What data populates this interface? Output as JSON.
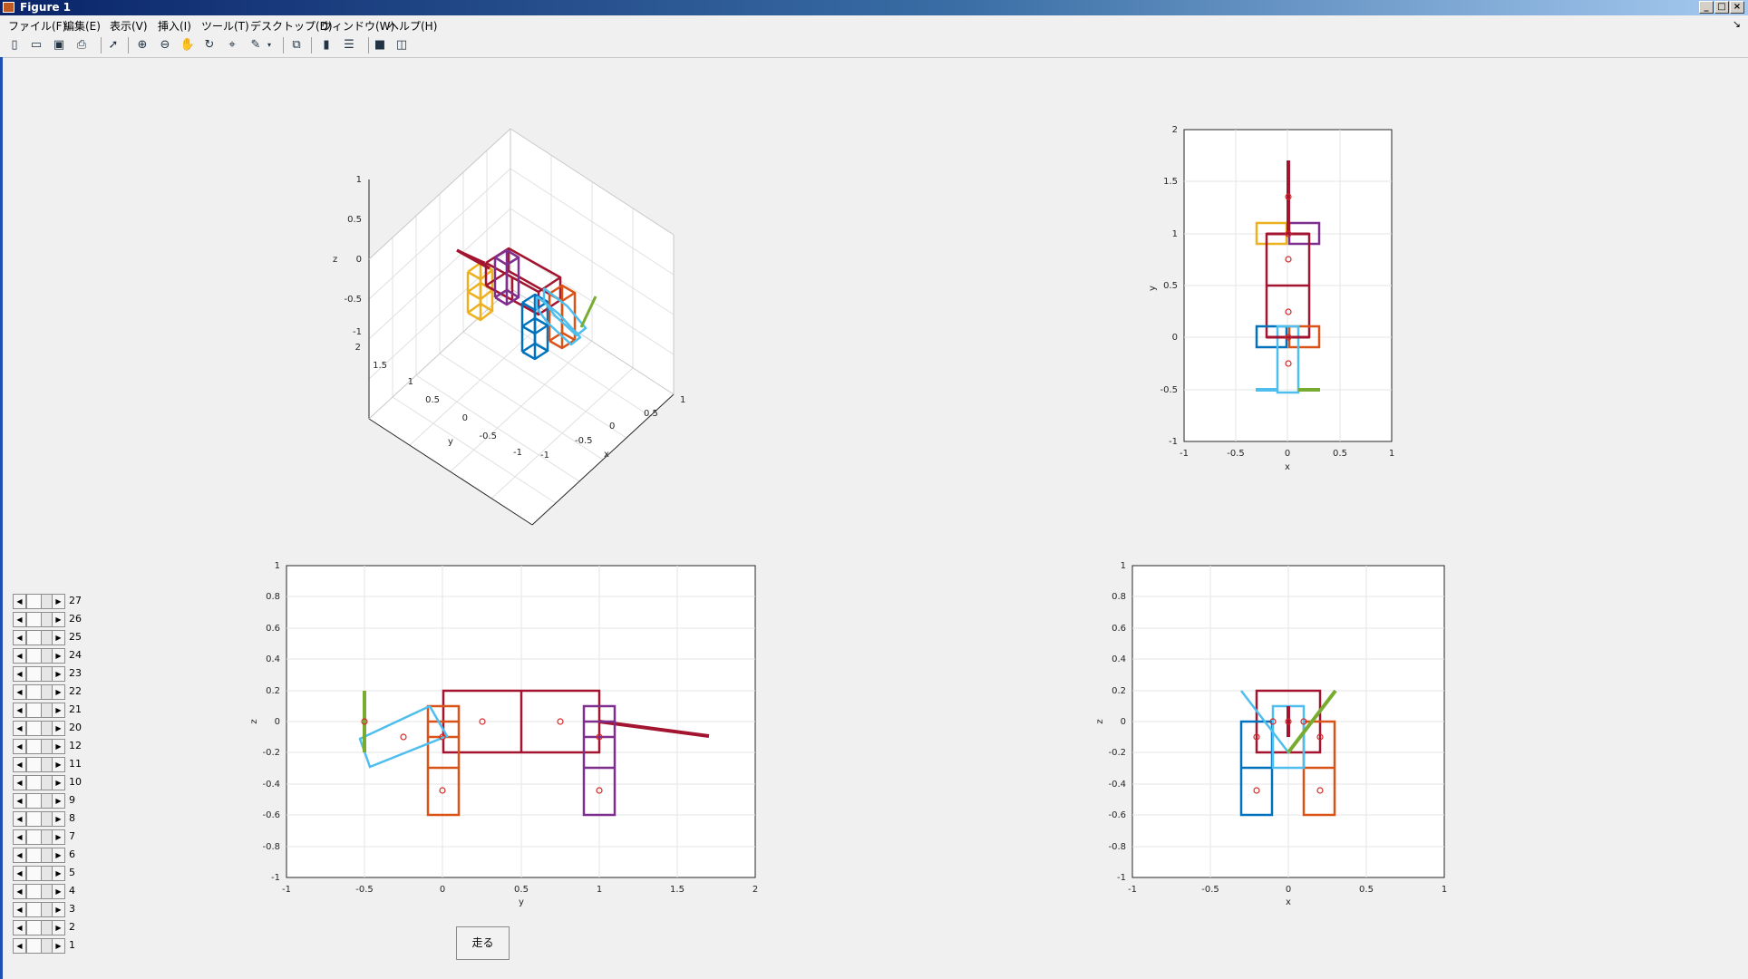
{
  "window": {
    "title": "Figure 1",
    "buttons": [
      "minimize",
      "maximize",
      "close"
    ]
  },
  "menu": [
    "ファイル(F)",
    "編集(E)",
    "表示(V)",
    "挿入(I)",
    "ツール(T)",
    "デスクトップ(D)",
    "ウィンドウ(W)",
    "ヘルプ(H)"
  ],
  "toolbar": [
    "new-figure-icon",
    "open-file-icon",
    "save-icon",
    "print-icon",
    "pointer-icon",
    "zoom-in-icon",
    "zoom-out-icon",
    "pan-icon",
    "rotate-3d-icon",
    "data-cursor-icon",
    "brush-icon",
    "link-plot-icon",
    "colorbar-icon",
    "legend-icon",
    "hide-plot-tools-icon",
    "show-plot-tools-icon"
  ],
  "axes": {
    "top_left_3d": {
      "xlabel": "x",
      "ylabel": "y",
      "zlabel": "z",
      "xticks": [
        "-1",
        "-0.5",
        "0",
        "0.5",
        "1"
      ],
      "yticks": [
        "-1",
        "-0.5",
        "0",
        "0.5",
        "1",
        "1.5",
        "2"
      ],
      "zticks": [
        "-1",
        "-0.5",
        "0",
        "0.5",
        "1"
      ]
    },
    "top_right_xy": {
      "xlabel": "x",
      "ylabel": "y",
      "xticks": [
        "-1",
        "-0.5",
        "0",
        "0.5",
        "1"
      ],
      "yticks": [
        "-1",
        "-0.5",
        "0",
        "0.5",
        "1",
        "1.5",
        "2"
      ]
    },
    "bottom_left_yz": {
      "xlabel": "y",
      "ylabel": "z",
      "xticks": [
        "-1",
        "-0.5",
        "0",
        "0.5",
        "1",
        "1.5",
        "2"
      ],
      "yticks": [
        "-1",
        "-0.8",
        "-0.6",
        "-0.4",
        "-0.2",
        "0",
        "0.2",
        "0.4",
        "0.6",
        "0.8",
        "1"
      ]
    },
    "bottom_right_xz": {
      "xlabel": "x",
      "ylabel": "z",
      "xticks": [
        "-1",
        "-0.5",
        "0",
        "0.5",
        "1"
      ],
      "yticks": [
        "-1",
        "-0.8",
        "-0.6",
        "-0.4",
        "-0.2",
        "0",
        "0.2",
        "0.4",
        "0.6",
        "0.8",
        "1"
      ]
    }
  },
  "sliders": [
    "27",
    "26",
    "25",
    "24",
    "23",
    "22",
    "21",
    "20",
    "12",
    "11",
    "10",
    "9",
    "8",
    "7",
    "6",
    "5",
    "4",
    "3",
    "2",
    "1"
  ],
  "run_button": {
    "label": "走る"
  },
  "colors": {
    "maroon": "#a2142f",
    "purple": "#7e2f8e",
    "blue": "#0072bd",
    "orange": "#d95319",
    "yellow": "#edb120",
    "cyan": "#4dbeee",
    "green": "#77ac30"
  }
}
